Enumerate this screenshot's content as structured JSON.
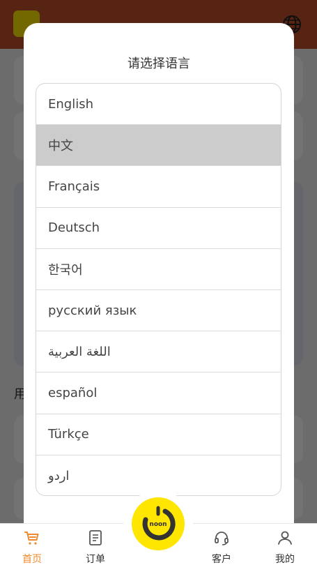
{
  "modal": {
    "title": "请选择语言",
    "languages": [
      {
        "label": "English",
        "selected": false
      },
      {
        "label": "中文",
        "selected": true
      },
      {
        "label": "Français",
        "selected": false
      },
      {
        "label": "Deutsch",
        "selected": false
      },
      {
        "label": "한국어",
        "selected": false
      },
      {
        "label": "русский язык",
        "selected": false
      },
      {
        "label": "اللغة العربية",
        "selected": false
      },
      {
        "label": "español",
        "selected": false
      },
      {
        "label": "Türkçe",
        "selected": false
      },
      {
        "label": "اردو",
        "selected": false
      }
    ]
  },
  "background": {
    "partial_text": "用"
  },
  "brand": {
    "logo_text": "noon",
    "accent": "#f08a2e",
    "header_color": "#c0502a",
    "logo_yellow": "#ffe600"
  },
  "bottom_nav": {
    "items": [
      {
        "label": "首页",
        "icon": "cart-icon",
        "active": true
      },
      {
        "label": "订单",
        "icon": "document-icon",
        "active": false
      },
      {
        "label": "客户",
        "icon": "headset-icon",
        "active": false
      },
      {
        "label": "我的",
        "icon": "user-icon",
        "active": false
      }
    ]
  }
}
